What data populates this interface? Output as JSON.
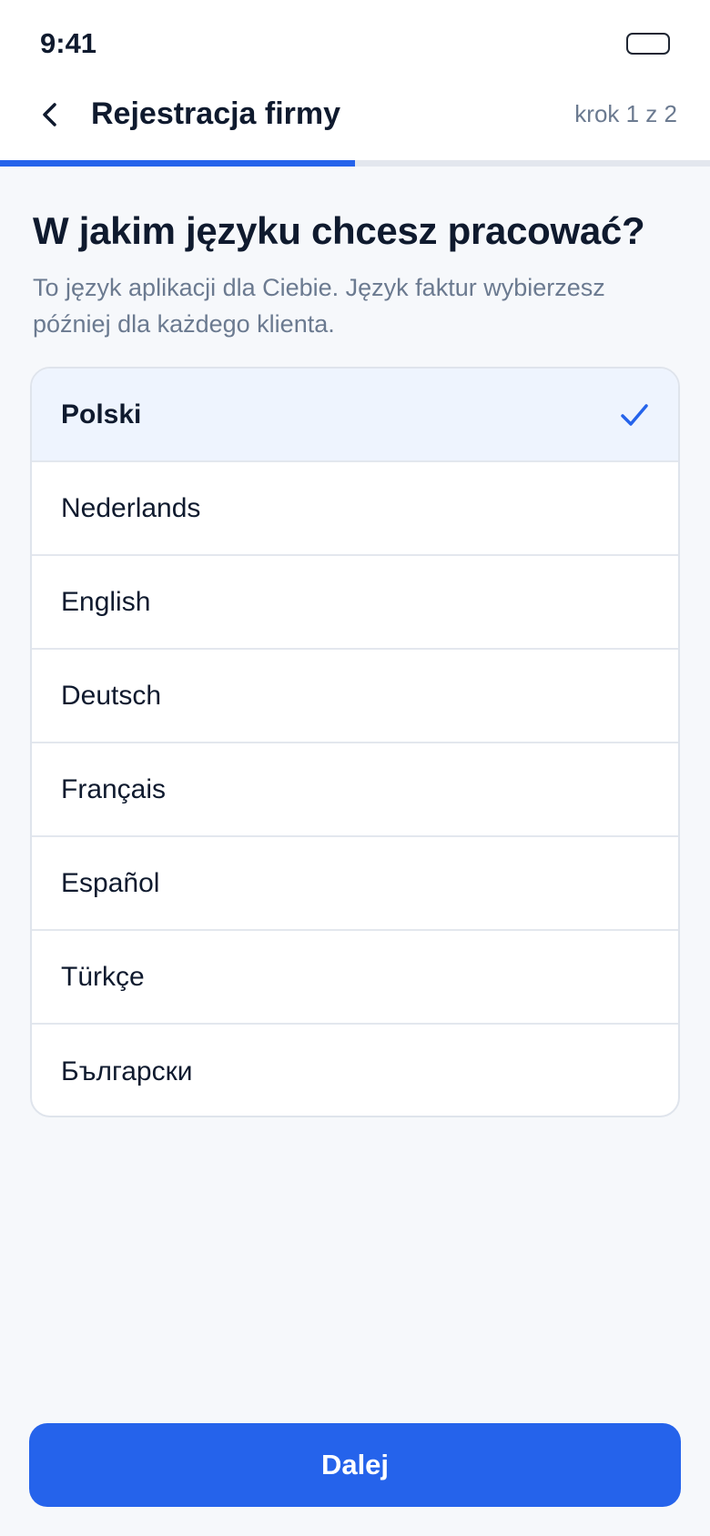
{
  "status_bar": {
    "time": "9:41",
    "battery_icon": "battery-icon"
  },
  "header": {
    "back_icon": "chevron-left-icon",
    "title": "Rejestracja firmy",
    "step": "krok 1 z 2"
  },
  "progress": {
    "current_step": 1,
    "total_steps": 2,
    "fraction": 0.5,
    "color": "#2563eb"
  },
  "main": {
    "question": "W jakim języku chcesz pracować?",
    "subtitle": "To język aplikacji dla Ciebie. Język faktur wybierzesz później dla każdego klienta."
  },
  "languages": {
    "selected_index": 0,
    "check_icon": "check-icon",
    "items": [
      {
        "label": "Polski",
        "selected": true
      },
      {
        "label": "Nederlands",
        "selected": false
      },
      {
        "label": "English",
        "selected": false
      },
      {
        "label": "Deutsch",
        "selected": false
      },
      {
        "label": "Français",
        "selected": false
      },
      {
        "label": "Español",
        "selected": false
      },
      {
        "label": "Türkçe",
        "selected": false
      },
      {
        "label": "Български",
        "selected": false
      }
    ]
  },
  "footer": {
    "next_label": "Dalej",
    "accent_color": "#2563eb"
  }
}
